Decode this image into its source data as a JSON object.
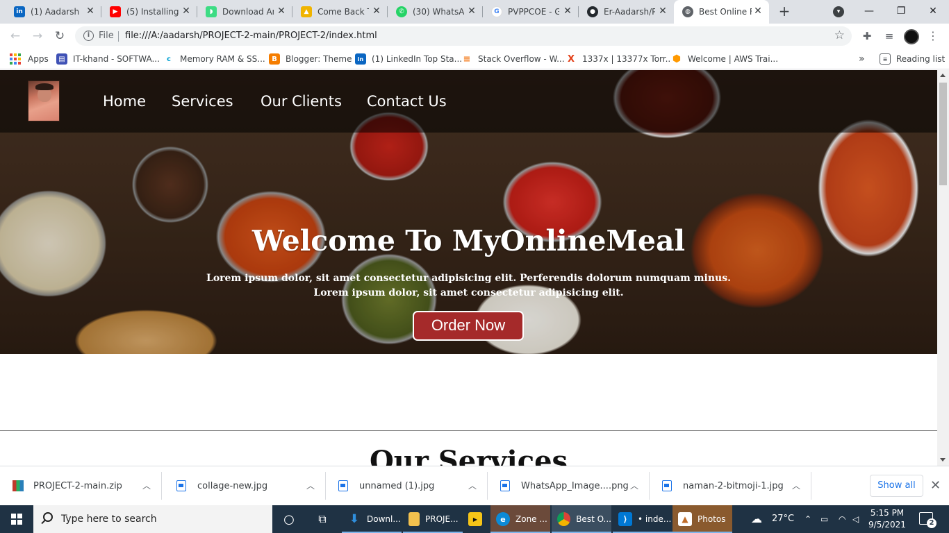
{
  "browser": {
    "tabs": [
      {
        "title": "(1) Aadarsh D",
        "icon": "linkedin-icon",
        "color": "#0a66c2",
        "glyph": "in"
      },
      {
        "title": "(5) Installing A",
        "icon": "youtube-icon",
        "color": "#ff0000",
        "glyph": "▶"
      },
      {
        "title": "Download An",
        "icon": "android-icon",
        "color": "#3ddc84",
        "glyph": "◗"
      },
      {
        "title": "Come Back To",
        "icon": "praying-hands-icon",
        "color": "#f0b400",
        "glyph": "▲"
      },
      {
        "title": "(30) WhatsAp",
        "icon": "whatsapp-icon",
        "color": "#25d366",
        "glyph": "✆"
      },
      {
        "title": "PVPPCOE - Gc",
        "icon": "google-icon",
        "color": "#4285f4",
        "glyph": "G"
      },
      {
        "title": "Er-Aadarsh/Pl",
        "icon": "github-icon",
        "color": "#24292e",
        "glyph": "●"
      },
      {
        "title": "Best Online Fo",
        "icon": "globe-icon",
        "color": "#5f6368",
        "glyph": "◍",
        "active": true
      }
    ],
    "scheme_label": "File",
    "url": "file:///A:/aadarsh/PROJECT-2-main/PROJECT-2/index.html",
    "bookmarks": [
      {
        "label": "Apps",
        "icon": "apps-grid-icon"
      },
      {
        "label": "IT-khand - SOFTWA...",
        "icon": "itkhand-icon",
        "color": "#3f51b5",
        "glyph": "▤"
      },
      {
        "label": "Memory RAM & SS...",
        "icon": "crucial-icon",
        "color": "#00a0d2",
        "glyph": "c"
      },
      {
        "label": "Blogger: Theme",
        "icon": "blogger-icon",
        "color": "#f57d00",
        "glyph": "B"
      },
      {
        "label": "(1) LinkedIn Top Sta...",
        "icon": "linkedin-icon",
        "color": "#0a66c2",
        "glyph": "in"
      },
      {
        "label": "Stack Overflow - W...",
        "icon": "stackoverflow-icon",
        "color": "#f48024",
        "glyph": "≡"
      },
      {
        "label": "1337x | 13377x Torr...",
        "icon": "1337x-icon",
        "color": "#e3411a",
        "glyph": "X"
      },
      {
        "label": "Welcome | AWS Trai...",
        "icon": "aws-icon",
        "color": "#ff9900",
        "glyph": "⬢"
      }
    ],
    "overflow_label": "»",
    "reading_list_label": "Reading list"
  },
  "site": {
    "nav": [
      {
        "label": "Home"
      },
      {
        "label": "Services"
      },
      {
        "label": "Our Clients"
      },
      {
        "label": "Contact Us"
      }
    ],
    "hero_title": "Welcome To MyOnlineMeal",
    "hero_line1": "Lorem ipsum dolor, sit amet consectetur adipisicing elit. Perferendis dolorum numquam minus.",
    "hero_line2": "Lorem ipsum dolor, sit amet consectetur adipisicing elit.",
    "order_button": "Order Now",
    "services_heading": "Our Services",
    "accent_color": "#a52a2a"
  },
  "downloads": {
    "items": [
      {
        "name": "PROJECT-2-main.zip",
        "icon": "zip-file-icon"
      },
      {
        "name": "collage-new.jpg",
        "icon": "image-file-icon"
      },
      {
        "name": "unnamed (1).jpg",
        "icon": "image-file-icon"
      },
      {
        "name": "WhatsApp_Image....png",
        "icon": "image-file-icon"
      },
      {
        "name": "naman-2-bitmoji-1.jpg",
        "icon": "image-file-icon"
      }
    ],
    "show_all": "Show all"
  },
  "taskbar": {
    "search_placeholder": "Type here to search",
    "apps": [
      {
        "label": "Downl...",
        "icon": "download-arrow-icon",
        "color": "#2f8fdd"
      },
      {
        "label": "PROJE...",
        "icon": "folder-icon",
        "color": "#f2c14e"
      },
      {
        "label": "",
        "icon": "player-icon",
        "color": "#f5c518"
      },
      {
        "label": "Zone ...",
        "icon": "edge-icon",
        "color": "#0c8ad6"
      },
      {
        "label": "Best O...",
        "icon": "chrome-icon",
        "color": "#db4437"
      },
      {
        "label": "• inde...",
        "icon": "vscode-icon",
        "color": "#0078d4"
      },
      {
        "label": "Photos",
        "icon": "photos-icon",
        "color": "#c06c28"
      }
    ],
    "temperature": "27°C",
    "time": "5:15 PM",
    "date": "9/5/2021",
    "notification_count": "2"
  }
}
